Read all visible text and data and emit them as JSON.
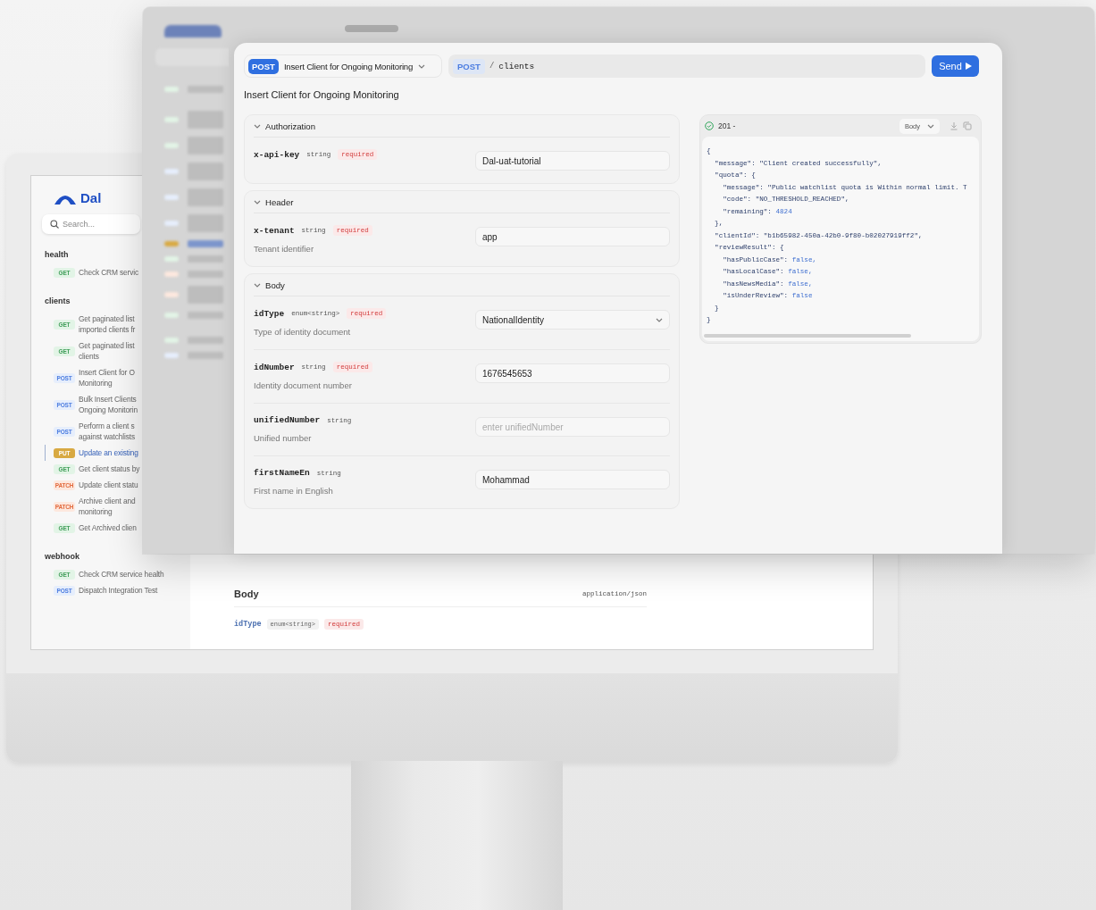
{
  "monitor_screen": {
    "logo": "Dal",
    "search": {
      "placeholder": "Search..."
    },
    "sidebar_groups": [
      {
        "title": "health",
        "items": [
          {
            "method": "GET",
            "lines": [
              "Check CRM servic"
            ],
            "selected": false
          }
        ]
      },
      {
        "title": "clients",
        "items": [
          {
            "method": "GET",
            "lines": [
              "Get paginated list",
              "imported clients fr"
            ],
            "selected": false
          },
          {
            "method": "GET",
            "lines": [
              "Get paginated list",
              "clients"
            ],
            "selected": false
          },
          {
            "method": "POST",
            "lines": [
              "Insert Client for O",
              "Monitoring"
            ],
            "selected": false
          },
          {
            "method": "POST",
            "lines": [
              "Bulk Insert Clients",
              "Ongoing Monitorin"
            ],
            "selected": false
          },
          {
            "method": "POST",
            "lines": [
              "Perform a client s",
              "against watchlists"
            ],
            "selected": false
          },
          {
            "method": "PUT",
            "lines": [
              "Update an existing"
            ],
            "selected": true
          },
          {
            "method": "GET",
            "lines": [
              "Get client status by"
            ],
            "selected": false
          },
          {
            "method": "PATCH",
            "lines": [
              "Update client statu"
            ],
            "selected": false
          },
          {
            "method": "PATCH",
            "lines": [
              "Archive client and",
              "monitoring"
            ],
            "selected": false
          },
          {
            "method": "GET",
            "lines": [
              "Get Archived clien"
            ],
            "selected": false
          }
        ]
      },
      {
        "title": "webhook",
        "items": [
          {
            "method": "GET",
            "lines": [
              "Check CRM service health"
            ],
            "selected": false
          },
          {
            "method": "POST",
            "lines": [
              "Dispatch Integration Test"
            ],
            "selected": false
          }
        ]
      }
    ],
    "body_section": {
      "title": "Body",
      "content_type": "application/json",
      "field": {
        "name": "idType",
        "type": "enum<string>",
        "required_label": "required"
      }
    }
  },
  "request_window": {
    "endpoint_select": {
      "method": "POST",
      "label": "Insert Client for Ongoing Monitoring"
    },
    "url": {
      "method": "POST",
      "separator": "/",
      "path": "clients"
    },
    "send_button": "Send",
    "title": "Insert Client for Ongoing Monitoring",
    "sections": [
      {
        "title": "Authorization",
        "expanded": true,
        "fields": [
          {
            "name": "x-api-key",
            "type": "string",
            "required_label": "required",
            "kind": "text",
            "value": "Dal-uat-tutorial"
          }
        ]
      },
      {
        "title": "Header",
        "expanded": true,
        "fields": [
          {
            "name": "x-tenant",
            "type": "string",
            "required_label": "required",
            "description": "Tenant identifier",
            "kind": "text",
            "value": "app"
          }
        ]
      },
      {
        "title": "Body",
        "expanded": true,
        "fields": [
          {
            "name": "idType",
            "type": "enum<string>",
            "required_label": "required",
            "description": "Type of identity document",
            "kind": "select",
            "value": "NationalIdentity"
          },
          {
            "name": "idNumber",
            "type": "string",
            "required_label": "required",
            "description": "Identity document number",
            "kind": "text",
            "value": "1676545653"
          },
          {
            "name": "unifiedNumber",
            "type": "string",
            "description": "Unified number",
            "kind": "text",
            "placeholder": "enter unifiedNumber"
          },
          {
            "name": "firstNameEn",
            "type": "string",
            "description": "First name in English",
            "kind": "text",
            "value": "Mohammad"
          }
        ]
      }
    ],
    "response": {
      "status": "201 -",
      "view_select": "Body",
      "code_lines": [
        {
          "text": "{"
        },
        {
          "text": "  \"message\": \"Client created successfully\","
        },
        {
          "text": "  \"quota\": {"
        },
        {
          "text": "    \"message\": \"Public watchlist quota is Within normal limit. T"
        },
        {
          "text": "    \"code\": \"NO_THRESHOLD_REACHED\","
        },
        {
          "text": "    \"remaining\": ",
          "literal": "4824"
        },
        {
          "text": "  },"
        },
        {
          "text": "  \"clientId\": \"b1b65982-450a-42b0-9f80-b02027919ff2\","
        },
        {
          "text": "  \"reviewResult\": {"
        },
        {
          "text": "    \"hasPublicCase\": ",
          "literal": "false,"
        },
        {
          "text": "    \"hasLocalCase\": ",
          "literal": "false,"
        },
        {
          "text": "    \"hasNewsMedia\": ",
          "literal": "false,"
        },
        {
          "text": "    \"isUnderReview\": ",
          "literal": "false"
        },
        {
          "text": "  }"
        },
        {
          "text": "}"
        }
      ]
    }
  }
}
